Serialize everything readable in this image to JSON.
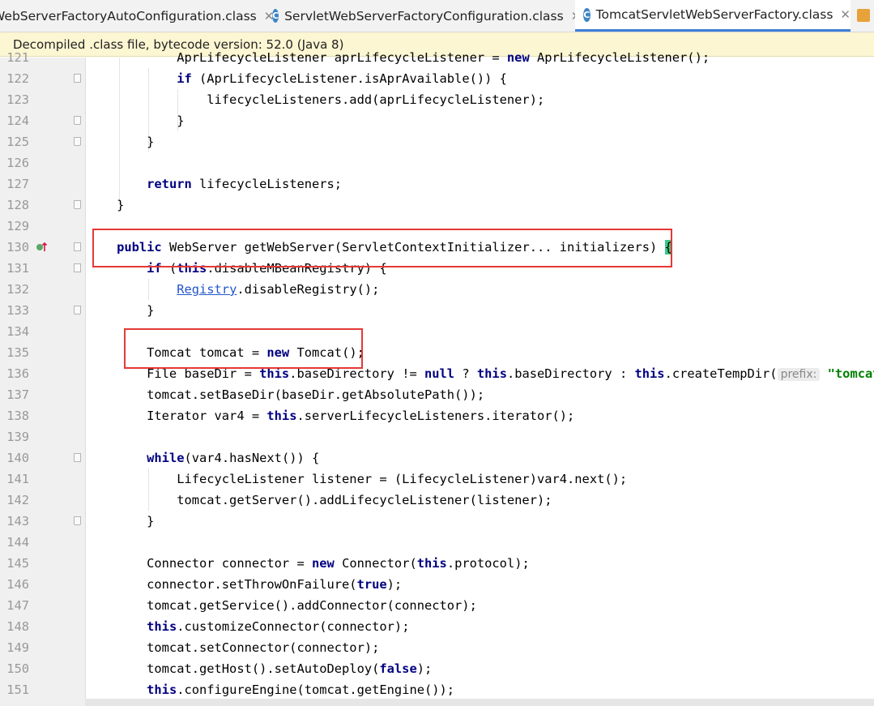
{
  "tabs": [
    {
      "label": "WebServerFactoryAutoConfiguration.class",
      "icon": "class-icon",
      "close": "✕",
      "active": false
    },
    {
      "label": "ServletWebServerFactoryConfiguration.class",
      "icon": "class-icon",
      "close": "✕",
      "active": false
    },
    {
      "label": "TomcatServletWebServerFactory.class",
      "icon": "class-icon",
      "close": "✕",
      "active": true
    }
  ],
  "banner": {
    "text": "Decompiled .class file, bytecode version: 52.0 (Java 8)"
  },
  "code_lines": [
    {
      "n": "121",
      "code": "            AprLifecycleListener aprLifecycleListener = new AprLifecycleListener();"
    },
    {
      "n": "122",
      "code": "            if (AprLifecycleListener.isAprAvailable()) {"
    },
    {
      "n": "123",
      "code": "                lifecycleListeners.add(aprLifecycleListener);"
    },
    {
      "n": "124",
      "code": "            }"
    },
    {
      "n": "125",
      "code": "        }"
    },
    {
      "n": "126",
      "code": ""
    },
    {
      "n": "127",
      "code": "        return lifecycleListeners;"
    },
    {
      "n": "128",
      "code": "    }"
    },
    {
      "n": "129",
      "code": ""
    },
    {
      "n": "130",
      "code": "    public WebServer getWebServer(ServletContextInitializer... initializers) {"
    },
    {
      "n": "131",
      "code": "        if (this.disableMBeanRegistry) {"
    },
    {
      "n": "132",
      "code": "            Registry.disableRegistry();"
    },
    {
      "n": "133",
      "code": "        }"
    },
    {
      "n": "134",
      "code": ""
    },
    {
      "n": "135",
      "code": "        Tomcat tomcat = new Tomcat();"
    },
    {
      "n": "136",
      "code": "        File baseDir = this.baseDirectory != null ? this.baseDirectory : this.createTempDir(\"tomcat\");"
    },
    {
      "n": "137",
      "code": "        tomcat.setBaseDir(baseDir.getAbsolutePath());"
    },
    {
      "n": "138",
      "code": "        Iterator var4 = this.serverLifecycleListeners.iterator();"
    },
    {
      "n": "139",
      "code": ""
    },
    {
      "n": "140",
      "code": "        while(var4.hasNext()) {"
    },
    {
      "n": "141",
      "code": "            LifecycleListener listener = (LifecycleListener)var4.next();"
    },
    {
      "n": "142",
      "code": "            tomcat.getServer().addLifecycleListener(listener);"
    },
    {
      "n": "143",
      "code": "        }"
    },
    {
      "n": "144",
      "code": ""
    },
    {
      "n": "145",
      "code": "        Connector connector = new Connector(this.protocol);"
    },
    {
      "n": "146",
      "code": "        connector.setThrowOnFailure(true);"
    },
    {
      "n": "147",
      "code": "        tomcat.getService().addConnector(connector);"
    },
    {
      "n": "148",
      "code": "        this.customizeConnector(connector);"
    },
    {
      "n": "149",
      "code": "        tomcat.setConnector(connector);"
    },
    {
      "n": "150",
      "code": "        tomcat.getHost().setAutoDeploy(false);"
    },
    {
      "n": "151",
      "code": "        this.configureEngine(tomcat.getEngine());"
    }
  ],
  "param_hint": "prefix:",
  "keywords": [
    "public",
    "new",
    "if",
    "this",
    "return",
    "null",
    "while",
    "true",
    "false"
  ],
  "links": [
    "Registry"
  ],
  "colors": {
    "keyword": "#000080",
    "string": "#008000",
    "link": "#2255cc",
    "highlight_box": "#e53935",
    "banner": "#fcf6d2",
    "active_tab": "#3d7fd6"
  }
}
